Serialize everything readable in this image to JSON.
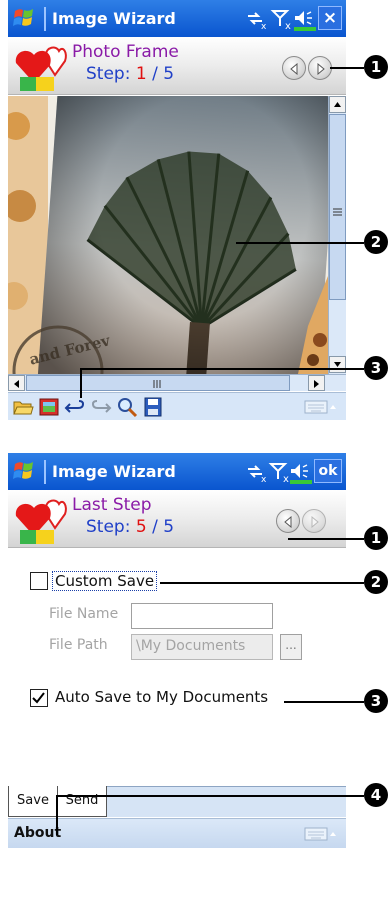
{
  "screen1": {
    "title": "Image Wizard",
    "close_label": "×",
    "step_name": "Photo Frame",
    "step_prefix": "Step: ",
    "step_current": "1",
    "step_sep": " / ",
    "step_total": "5",
    "watermark_text": "and Forev"
  },
  "screen2": {
    "title": "Image Wizard",
    "ok_label": "ok",
    "step_name": "Last Step",
    "step_prefix": "Step: ",
    "step_current": "5",
    "step_sep": " / ",
    "step_total": "5",
    "custom_save": {
      "label": "Custom Save",
      "checked": false
    },
    "file_name": {
      "label": "File Name",
      "value": ""
    },
    "file_path": {
      "label": "File Path",
      "value": "\\My Documents",
      "browse_label": "..."
    },
    "auto_save": {
      "label": "Auto Save to My Documents",
      "checked": true
    },
    "tabs": [
      {
        "label": "Save"
      },
      {
        "label": "Send"
      }
    ],
    "menu": {
      "about": "About"
    }
  },
  "callouts": {
    "badge_1": "1",
    "badge_2": "2",
    "badge_3": "3",
    "badge_4": "4"
  },
  "icons": {
    "toolbar": [
      "open-folder-icon",
      "frame-icon",
      "undo-icon",
      "redo-icon",
      "zoom-icon",
      "save-disk-icon"
    ],
    "status": [
      "connectivity-icon",
      "signal-off-icon",
      "volume-icon"
    ]
  },
  "colors": {
    "titlebar": "#0a55cf",
    "step_name": "#8a1aa7",
    "step_line": "#2040c8",
    "step_current": "#e01010",
    "callout": "#000000"
  }
}
